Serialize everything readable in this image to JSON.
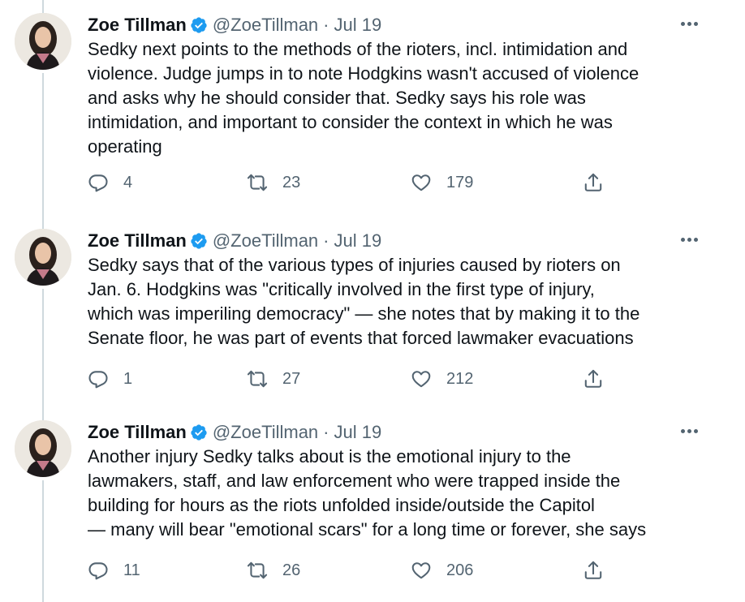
{
  "tweets": [
    {
      "name": "Zoe Tillman",
      "handle": "@ZoeTillman",
      "separator": "·",
      "date": "Jul 19",
      "text": "Sedky next points to the methods of the rioters, incl. intimidation and\nviolence. Judge jumps in to note Hodgkins wasn't accused of violence\nand asks why he should consider that. Sedky says his role was\nintimidation, and important to consider the context in which he was\noperating",
      "replies": "4",
      "retweets": "23",
      "likes": "179"
    },
    {
      "name": "Zoe Tillman",
      "handle": "@ZoeTillman",
      "separator": "·",
      "date": "Jul 19",
      "text": "Sedky says that of the various types of injuries caused by rioters on\nJan. 6. Hodgkins was \"critically involved in the first type of injury,\nwhich was imperiling democracy\" — she notes that by making it to the\nSenate floor, he was part of events that forced lawmaker evacuations",
      "replies": "1",
      "retweets": "27",
      "likes": "212"
    },
    {
      "name": "Zoe Tillman",
      "handle": "@ZoeTillman",
      "separator": "·",
      "date": "Jul 19",
      "text": "Another injury Sedky talks about is the emotional injury to the\nlawmakers, staff, and law enforcement who were trapped inside the\nbuilding for hours as the riots unfolded inside/outside the Capitol\n— many will bear \"emotional scars\" for a long time or forever, she says",
      "replies": "11",
      "retweets": "26",
      "likes": "206"
    }
  ],
  "colors": {
    "verified": "#1d9bf0",
    "muted": "#536471",
    "thread_line": "#cfd9de"
  }
}
